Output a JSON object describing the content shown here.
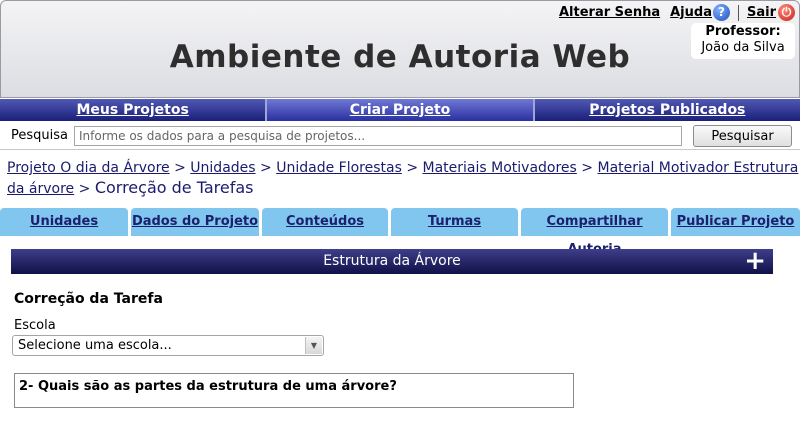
{
  "header": {
    "title": "Ambiente de Autoria Web",
    "links": {
      "alterar_senha": "Alterar Senha",
      "ajuda": "Ajuda",
      "sair": "Sair"
    },
    "professor": {
      "label": "Professor:",
      "name": "João da Silva"
    },
    "icons": {
      "help": "help-icon",
      "logout": "power-icon"
    }
  },
  "main_nav": {
    "items": [
      "Meus Projetos",
      "Criar Projeto",
      "Projetos Publicados"
    ],
    "active": "Criar Projeto"
  },
  "search": {
    "label": "Pesquisa",
    "placeholder": "Informe os dados para a pesquisa de projetos...",
    "value": "",
    "button": "Pesquisar"
  },
  "breadcrumb": {
    "links": [
      "Projeto O dia da Árvore",
      "Unidades",
      "Unidade Florestas",
      "Materiais Motivadores",
      "Material Motivador Estrutura da árvore"
    ],
    "separator": ">",
    "current": "Correção de Tarefas"
  },
  "sub_tabs": [
    "Unidades",
    "Dados do Projeto",
    "Conteúdos",
    "Turmas",
    "Compartilhar Autoria",
    "Publicar Projeto"
  ],
  "panel": {
    "header": "Estrutura da Árvore",
    "section_title": "Correção da Tarefa",
    "escola_label": "Escola",
    "escola_select": "Selecione uma escola...",
    "question": "2- Quais são as partes  da estrutura de uma árvore?"
  },
  "colors": {
    "nav_bg": "#1a1f7a",
    "subtab_bg": "#80c6ee",
    "panel_header_bg": "#0f1047",
    "link_color": "#1b1b6e"
  }
}
